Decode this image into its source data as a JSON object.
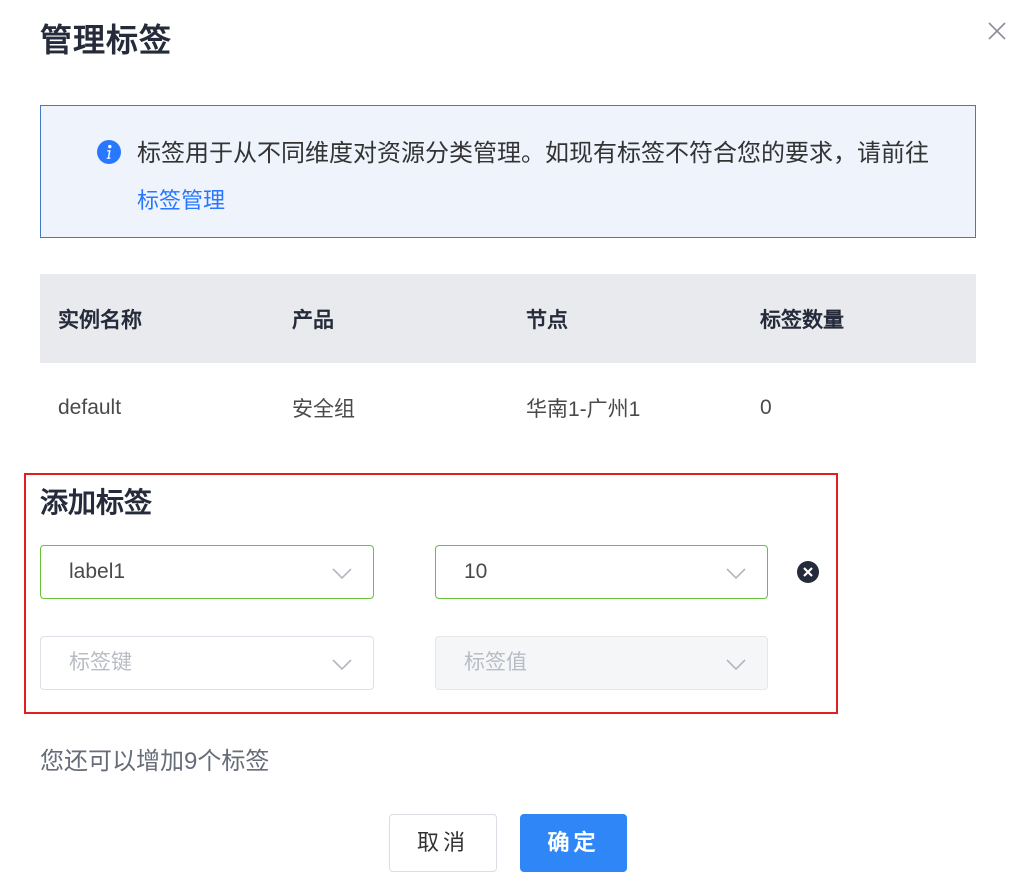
{
  "dialog": {
    "title": "管理标签"
  },
  "info": {
    "text": "标签用于从不同维度对资源分类管理。如现有标签不符合您的要求，请前往",
    "link_label": "标签管理"
  },
  "table": {
    "headers": [
      "实例名称",
      "产品",
      "节点",
      "标签数量"
    ],
    "rows": [
      [
        "default",
        "安全组",
        "华南1-广州1",
        "0"
      ]
    ]
  },
  "add_tags": {
    "title": "添加标签",
    "rows": [
      {
        "key_value": "label1",
        "value_value": "10"
      },
      {
        "key_placeholder": "标签键",
        "value_placeholder": "标签值"
      }
    ]
  },
  "hint": "您还可以增加9个标签",
  "buttons": {
    "cancel": "取消",
    "ok": "确定"
  },
  "colors": {
    "accent": "#2f86f6",
    "link": "#2878ff",
    "info_bg": "#eef3fc",
    "active_border": "#67c23a",
    "highlight_border": "#e02020"
  }
}
